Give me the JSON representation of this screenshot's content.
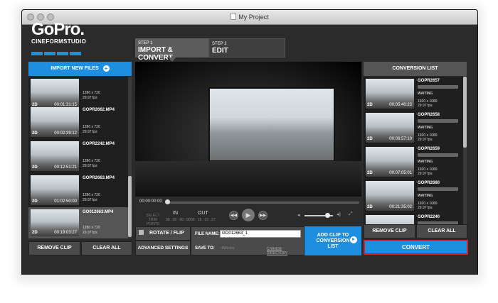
{
  "window": {
    "title": "My Project"
  },
  "logo": {
    "brand": "GoPro.",
    "product": "CINEFORMSTUDIO"
  },
  "steps": [
    {
      "number": "STEP 1",
      "label": "IMPORT & CONVERT",
      "active": true
    },
    {
      "number": "STEP 2",
      "label": "EDIT",
      "active": false
    }
  ],
  "left_panel": {
    "import_label": "IMPORT NEW FILES",
    "clips": [
      {
        "name": "",
        "badge": "2D",
        "duration": "00:01:31:15",
        "resolution": "1280 x 720",
        "fps": "29.97 fps",
        "selected": false
      },
      {
        "name": "GOPR2662.MP4",
        "badge": "2D",
        "duration": "00:02:39:12",
        "resolution": "1280 x 720",
        "fps": "29.97 fps",
        "selected": false
      },
      {
        "name": "GOPR2242.MP4",
        "badge": "2D",
        "duration": "00:12:51:21",
        "resolution": "1280 x 720",
        "fps": "29.97 fps",
        "selected": false
      },
      {
        "name": "GOPR2663.MP4",
        "badge": "2D",
        "duration": "01:02:50:00",
        "resolution": "1280 x 720",
        "fps": "29.97 fps",
        "selected": false
      },
      {
        "name": "GO012663.MP4",
        "badge": "2D",
        "duration": "00:19:03:27",
        "resolution": "1280 x 720",
        "fps": "29.97 fps",
        "selected": true
      }
    ],
    "remove_label": "REMOVE CLIP",
    "clear_label": "CLEAR ALL"
  },
  "player": {
    "timecode": "00:00:00:00",
    "select_trim_label": "SELECT\nTRIM POINTS",
    "in_label": "IN",
    "in_time": "00 : 00 : 00 : 00",
    "out_label": "OUT",
    "out_time": "00 : 19 : 03 : 27",
    "volume_level": 0.75
  },
  "bottom": {
    "rotate_label": "ROTATE / FLIP",
    "advanced_label": "ADVANCED SETTINGS",
    "file_name_label": "FILE NAME:",
    "file_name_value": "GO012663_1",
    "save_to_label": "SAVE TO:",
    "save_to_path": "~/Movies",
    "change_dir_label": "CHANGE DIRECTORY",
    "add_clip_label": "ADD CLIP TO CONVERSION LIST"
  },
  "right_panel": {
    "header": "CONVERSION LIST",
    "items": [
      {
        "name": "GOPR2657",
        "badge": "2D",
        "duration": "00:05:40:23",
        "status": "WAITING",
        "resolution": "1920 x 1080",
        "fps": "29.97 fps"
      },
      {
        "name": "GOPR2658",
        "badge": "2D",
        "duration": "00:06:57:10",
        "status": "WAITING",
        "resolution": "1920 x 1080",
        "fps": "29.97 fps"
      },
      {
        "name": "GOPR2659",
        "badge": "2D",
        "duration": "00:07:05:01",
        "status": "WAITING",
        "resolution": "1920 x 1080",
        "fps": "29.97 fps"
      },
      {
        "name": "GOPR2660",
        "badge": "2D",
        "duration": "00:21:35:02",
        "status": "WAITING",
        "resolution": "1920 x 1080",
        "fps": "29.97 fps"
      },
      {
        "name": "GOPR2240",
        "badge": "",
        "duration": "",
        "status": "",
        "resolution": "",
        "fps": ""
      }
    ],
    "remove_label": "REMOVE CLIP",
    "clear_label": "CLEAR ALL",
    "convert_label": "CONVERT"
  },
  "colors": {
    "accent": "#1d8ee0",
    "highlight": "#d0232a",
    "panel": "#4a4a4a"
  }
}
